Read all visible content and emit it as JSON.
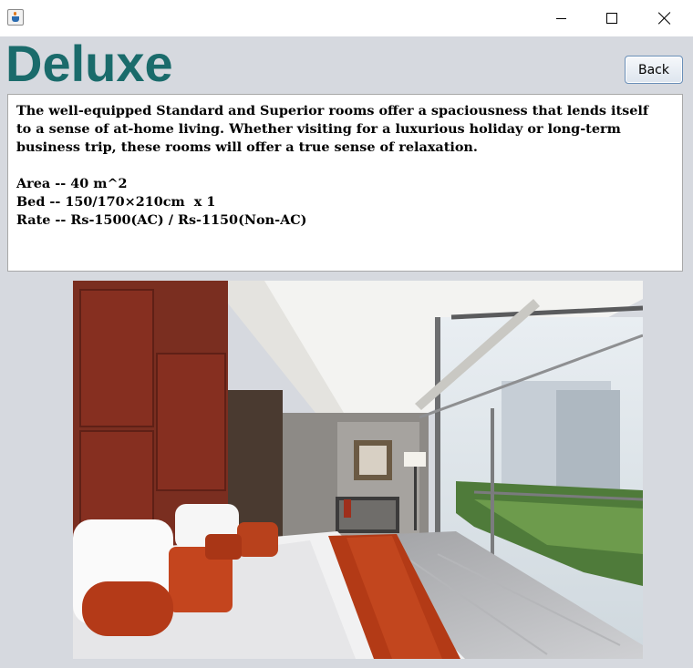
{
  "window": {
    "icon": "java-cup-icon"
  },
  "header": {
    "title": "Deluxe",
    "back_label": "Back"
  },
  "description": {
    "lines": [
      "The well-equipped Standard and Superior rooms offer a spaciousness that lends itself",
      "to a sense of at-home living. Whether visiting for a luxurious holiday or long-term",
      "business trip, these rooms will offer a true sense of relaxation.",
      "",
      "Area -- 40 m^2",
      "Bed -- 150/170×210cm  x 1",
      "Rate -- Rs-1500(AC) / Rs-1150(Non-AC)"
    ]
  },
  "photo": {
    "subject": "hotel-room-photo"
  },
  "colors": {
    "title": "#1a6b6b",
    "background": "#d6d9df"
  }
}
